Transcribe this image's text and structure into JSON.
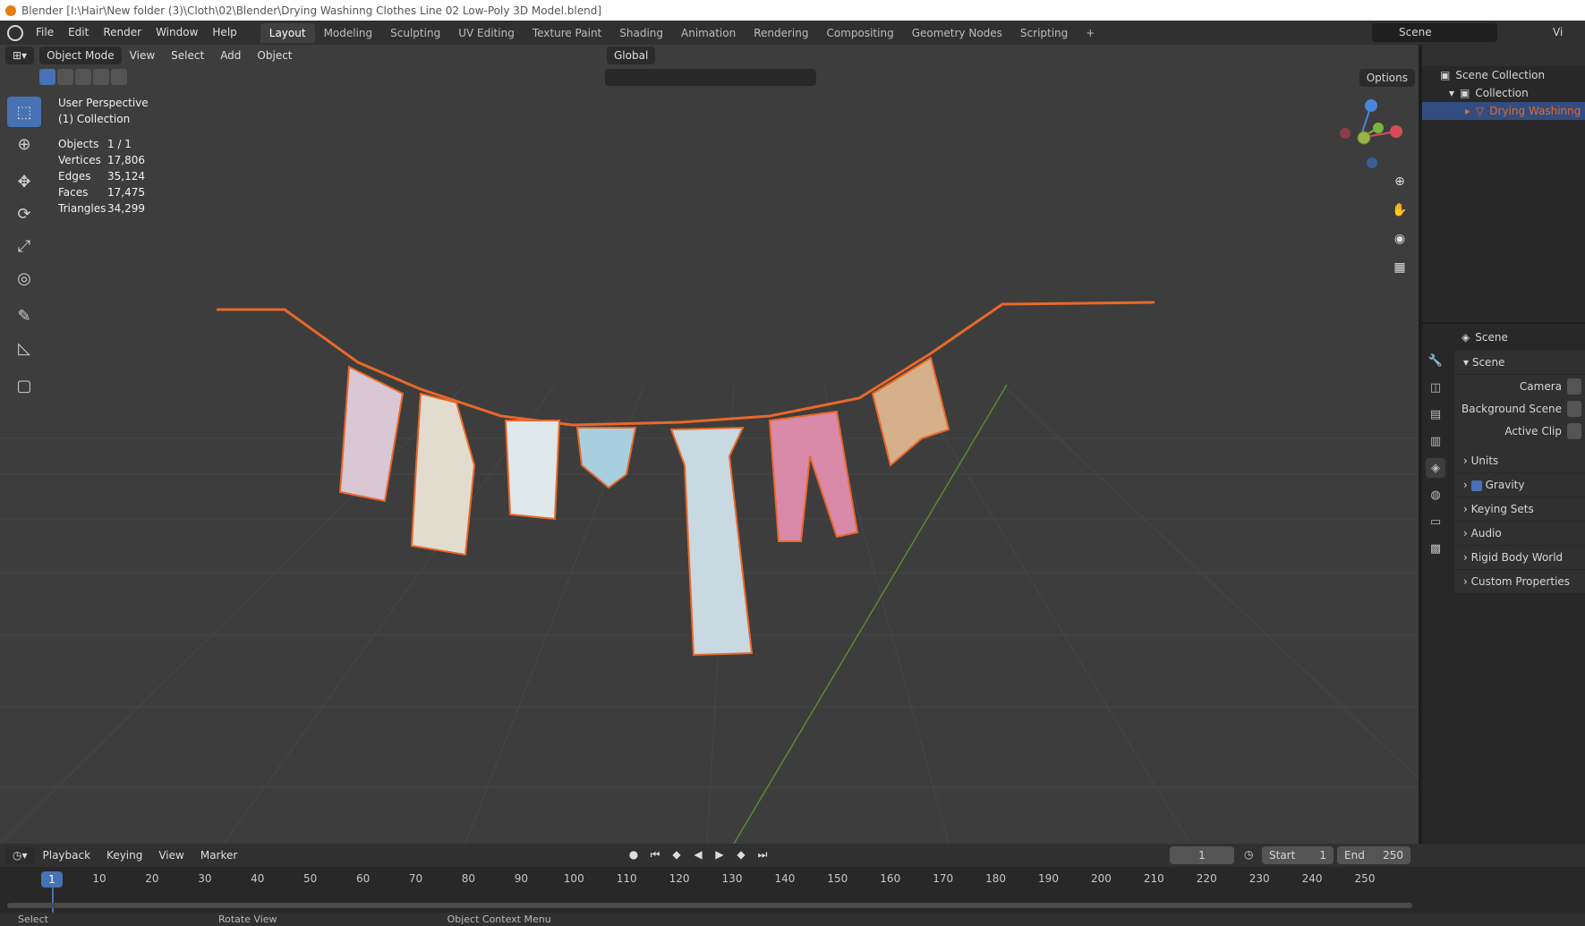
{
  "window_title": "Blender [I:\\Hair\\New folder (3)\\Cloth\\02\\Blender\\Drying Washinng Clothes Line 02 Low-Poly 3D Model.blend]",
  "menu": [
    "File",
    "Edit",
    "Render",
    "Window",
    "Help"
  ],
  "workspaces": [
    "Layout",
    "Modeling",
    "Sculpting",
    "UV Editing",
    "Texture Paint",
    "Shading",
    "Animation",
    "Rendering",
    "Compositing",
    "Geometry Nodes",
    "Scripting"
  ],
  "scene_name": "Scene",
  "view_layer": "Vi",
  "viewport": {
    "mode": "Object Mode",
    "menus": [
      "View",
      "Select",
      "Add",
      "Object"
    ],
    "orientation": "Global",
    "options_label": "Options",
    "view_name": "User Perspective",
    "collection_label": "(1) Collection",
    "stats": [
      {
        "label": "Objects",
        "value": "1 / 1"
      },
      {
        "label": "Vertices",
        "value": "17,806"
      },
      {
        "label": "Edges",
        "value": "35,124"
      },
      {
        "label": "Faces",
        "value": "17,475"
      },
      {
        "label": "Triangles",
        "value": "34,299"
      }
    ],
    "colors": {
      "selection_outline": "#e8682a",
      "background": "#3d3d3d"
    }
  },
  "outliner": {
    "scene_collection": "Scene Collection",
    "collection": "Collection",
    "object": "Drying Washinng Cl"
  },
  "properties": {
    "context": "Scene",
    "section": "Scene",
    "camera_label": "Camera",
    "background_scene_label": "Background Scene",
    "active_clip_label": "Active Clip",
    "panels": [
      "Units",
      "Gravity",
      "Keying Sets",
      "Audio",
      "Rigid Body World",
      "Custom Properties"
    ]
  },
  "timeline": {
    "menus": [
      "Playback",
      "Keying",
      "View",
      "Marker"
    ],
    "current_frame": "1",
    "start_label": "Start",
    "start": "1",
    "end_label": "End",
    "end": "250",
    "ticks": [
      "1",
      "10",
      "20",
      "30",
      "40",
      "50",
      "60",
      "70",
      "80",
      "90",
      "100",
      "110",
      "120",
      "130",
      "140",
      "150",
      "160",
      "170",
      "180",
      "190",
      "200",
      "210",
      "220",
      "230",
      "240",
      "250"
    ]
  },
  "statusbar": [
    "Select",
    "Rotate View",
    "Object Context Menu"
  ]
}
